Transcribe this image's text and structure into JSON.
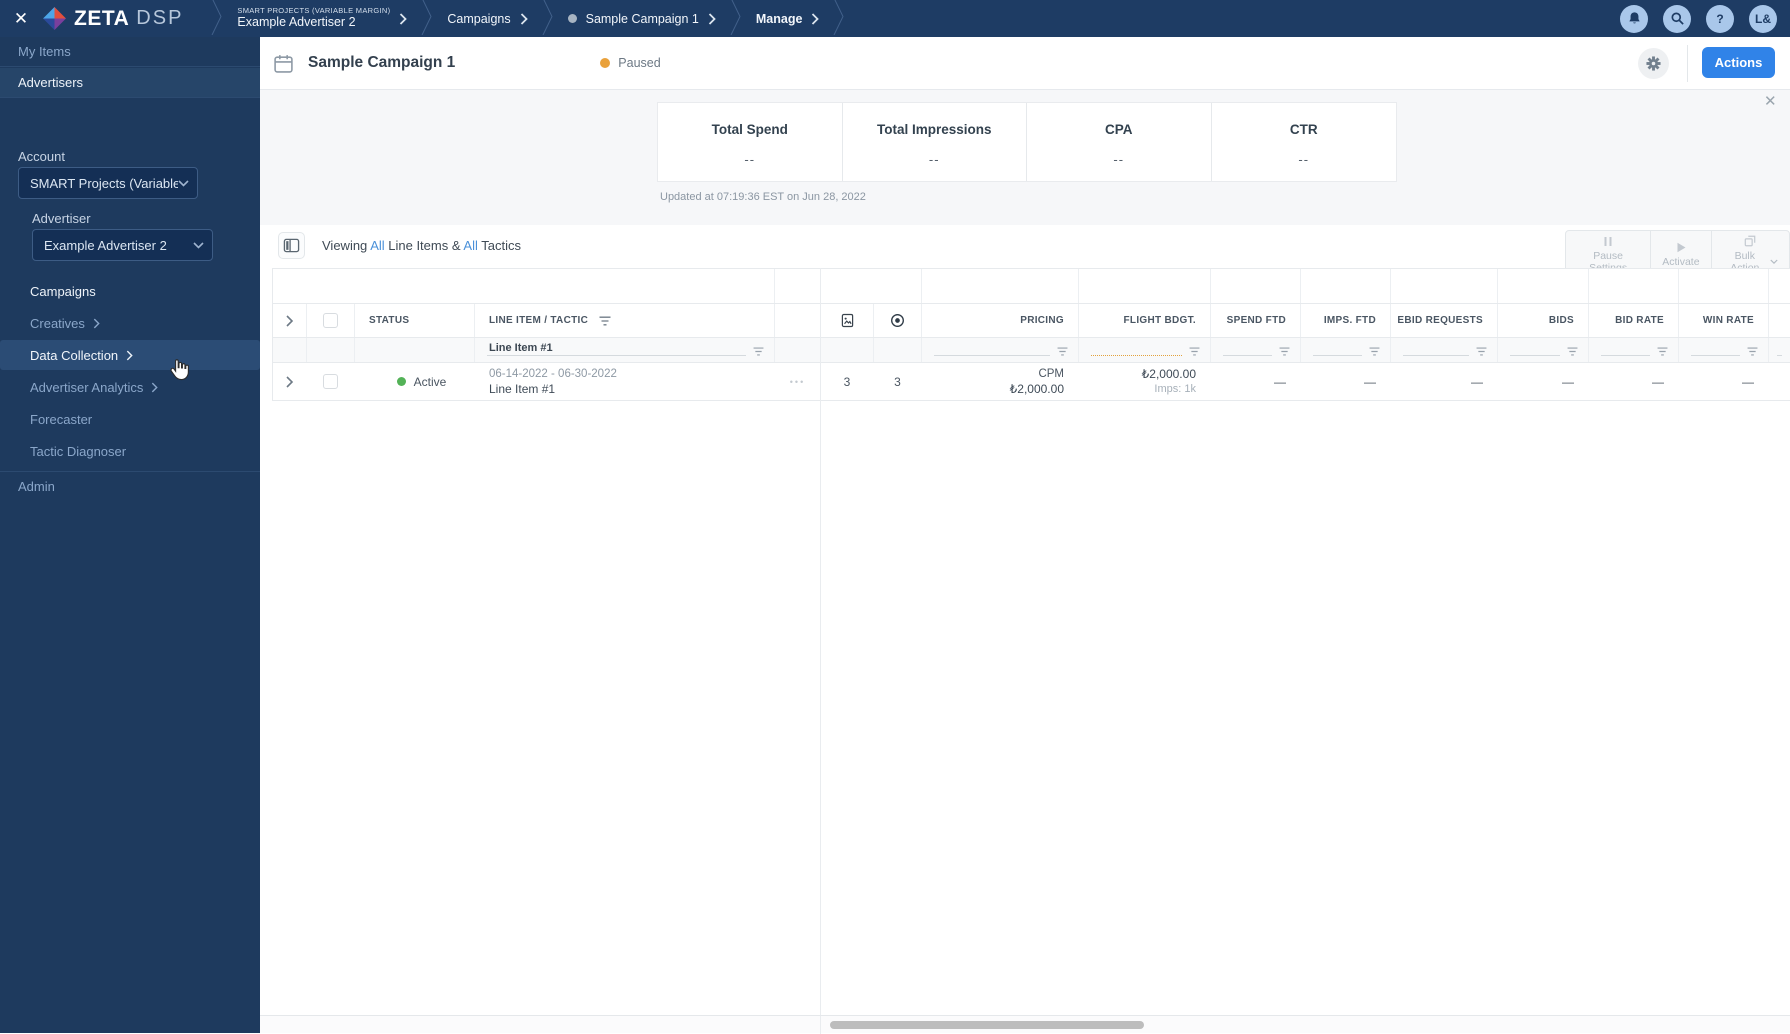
{
  "topbar": {
    "close_label": "✕",
    "brand": {
      "name": "ZETA",
      "suffix": "DSP"
    },
    "breadcrumbs": [
      {
        "eyebrow": "SMART PROJECTS (VARIABLE MARGIN)",
        "label": "Example Advertiser 2"
      },
      {
        "label": "Campaigns"
      },
      {
        "label": "Sample Campaign 1"
      },
      {
        "label": "Manage"
      }
    ],
    "help_label": "?",
    "avatar": "L&"
  },
  "sidebar": {
    "my_items": "My Items",
    "advertisers": "Advertisers",
    "account_label": "Account",
    "account_value": "SMART Projects (Variable M...",
    "advertiser_label": "Advertiser",
    "advertiser_value": "Example Advertiser 2",
    "nav": [
      {
        "label": "Campaigns"
      },
      {
        "label": "Creatives"
      },
      {
        "label": "Data Collection"
      },
      {
        "label": "Advertiser Analytics"
      },
      {
        "label": "Forecaster"
      },
      {
        "label": "Tactic Diagnoser"
      }
    ],
    "admin": "Admin"
  },
  "campaign_header": {
    "title": "Sample Campaign 1",
    "status": "Paused",
    "actions_label": "Actions"
  },
  "stats": {
    "metrics": [
      {
        "label": "Total Spend",
        "value": "--"
      },
      {
        "label": "Total Impressions",
        "value": "--"
      },
      {
        "label": "CPA",
        "value": "--"
      },
      {
        "label": "CTR",
        "value": "--"
      }
    ],
    "updated": "Updated at 07:19:36 EST on Jun 28, 2022",
    "close_label": "✕"
  },
  "toolbar": {
    "viewing": {
      "prefix": "Viewing ",
      "all1": "All",
      "mid": " Line Items & ",
      "all2": "All",
      "suffix": " Tactics"
    },
    "buttons": [
      {
        "label": "Pause Settings",
        "icon": "pause-icon"
      },
      {
        "label": "Activate",
        "icon": "play-icon"
      },
      {
        "label": "Bulk Action",
        "icon": "bulk-icon"
      }
    ]
  },
  "table": {
    "columns": {
      "status": "STATUS",
      "line_item": "LINE ITEM / TACTIC",
      "creatives_icon": "creative-file-icon",
      "tactics_icon": "target-icon",
      "pricing": "PRICING",
      "flight": "FLIGHT BDGT.",
      "spend_ftd": "SPEND FTD",
      "imps_ftd": "IMPS. FTD",
      "ebid": "EBID REQUESTS",
      "bids": "BIDS",
      "bid_rate": "BID RATE",
      "win_rate": "WIN RATE"
    },
    "filters": {
      "line_item": "Line Item #1"
    },
    "row": {
      "status": "Active",
      "dates": "06-14-2022 - 06-30-2022",
      "name": "Line Item #1",
      "menu": "•••",
      "creatives": "3",
      "tactics": "3",
      "pricing_type": "CPM",
      "pricing_value": "₺2,000.00",
      "flight_value": "₺2,000.00",
      "flight_sub": "Imps: 1k",
      "dash": "—"
    }
  },
  "colors": {
    "accent": "#3083e8",
    "paused": "#e9a13b",
    "active": "#53b257",
    "navy": "#1e3c64"
  }
}
